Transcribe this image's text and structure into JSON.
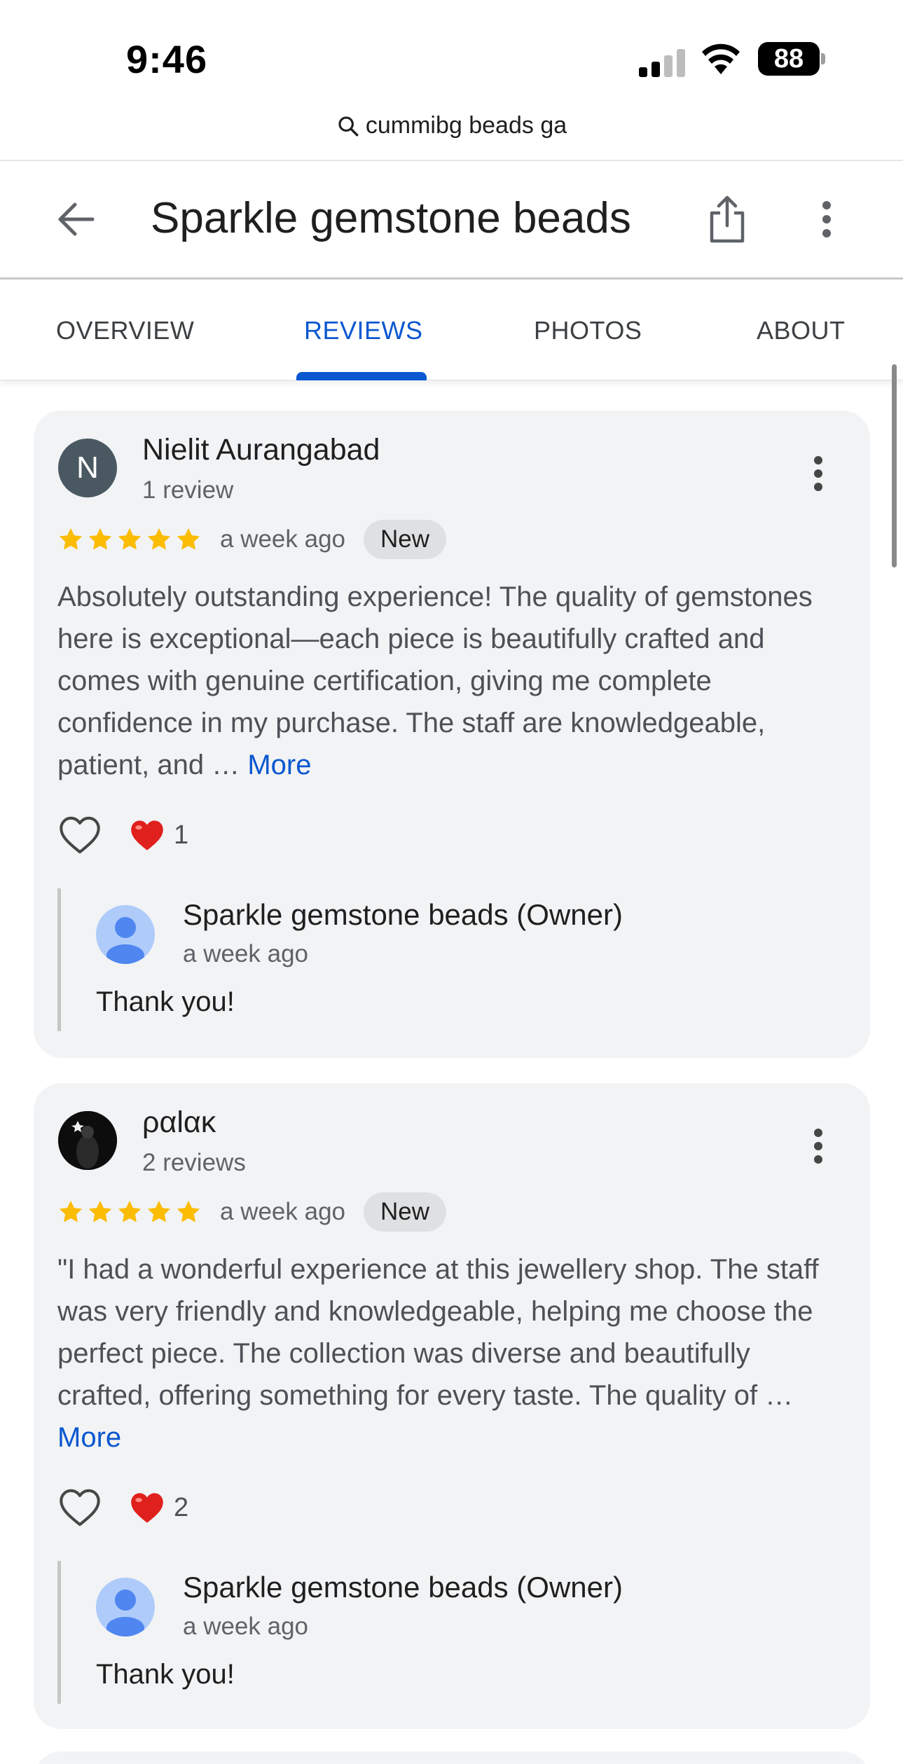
{
  "status_bar": {
    "time": "9:46",
    "battery": "88"
  },
  "search_query": "cummibg beads ga",
  "header": {
    "title": "Sparkle gemstone beads",
    "back_icon": "arrow-left-icon",
    "share_icon": "share-icon",
    "more_icon": "more-vert-icon"
  },
  "tabs": [
    {
      "label": "OVERVIEW",
      "active": false
    },
    {
      "label": "REVIEWS",
      "active": true
    },
    {
      "label": "PHOTOS",
      "active": false
    },
    {
      "label": "ABOUT",
      "active": false
    }
  ],
  "colors": {
    "accent": "#0b57d0",
    "star": "#fbbc04",
    "card_bg": "#f2f3f5"
  },
  "reviews": [
    {
      "avatar_letter": "N",
      "name": "Nielit Aurangabad",
      "review_count": "1 review",
      "rating": 5,
      "date": "a week ago",
      "badge": "New",
      "text": "Absolutely outstanding experience! The quality of gemstones here is exceptional—each piece is beautifully crafted and comes with genuine certification, giving me complete confidence in my purchase. The staff are knowledgeable, patient, and …",
      "more_label": "More",
      "reaction_count": "1",
      "owner_reply": {
        "name": "Sparkle gemstone beads (Owner)",
        "date": "a week ago",
        "text": "Thank you!"
      }
    },
    {
      "avatar_letter": "",
      "name": "ραlακ",
      "review_count": "2 reviews",
      "rating": 5,
      "date": "a week ago",
      "badge": "New",
      "text": "\"I had a wonderful experience at this jewellery shop. The staff was very friendly and knowledgeable, helping me choose the perfect piece. The collection was diverse and beautifully crafted, offering something for every taste. The quality of …",
      "more_label": "More",
      "reaction_count": "2",
      "owner_reply": {
        "name": "Sparkle gemstone beads (Owner)",
        "date": "a week ago",
        "text": "Thank you!"
      }
    }
  ]
}
